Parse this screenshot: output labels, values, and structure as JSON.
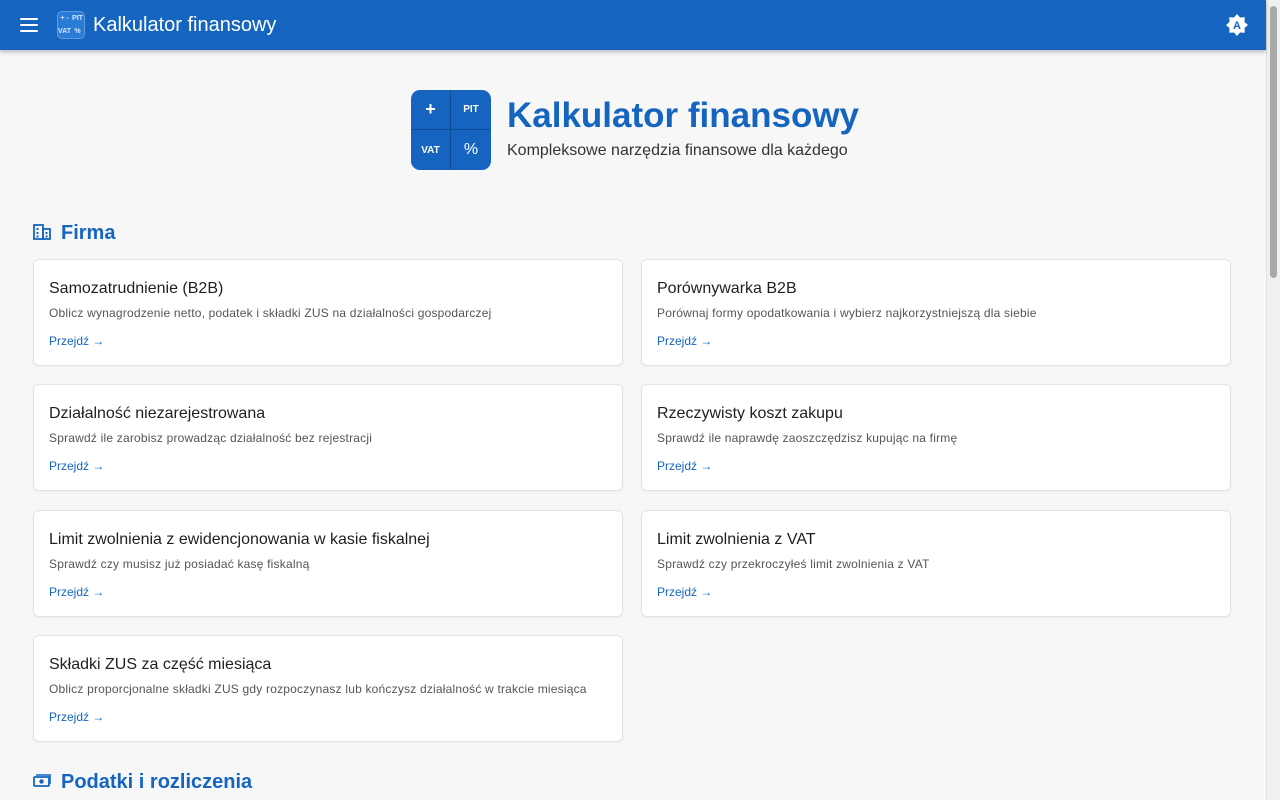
{
  "appbar": {
    "title": "Kalkulator finansowy",
    "logo_cells": [
      "+ -",
      "PIT",
      "VAT",
      "%"
    ],
    "theme_badge": "A"
  },
  "hero": {
    "title": "Kalkulator finansowy",
    "subtitle": "Kompleksowe narzędzia finansowe dla każdego",
    "logo_cells": [
      "+",
      "PIT",
      "VAT",
      "%"
    ]
  },
  "sections": [
    {
      "title": "Firma",
      "icon": "building-icon",
      "cards": [
        {
          "title": "Samozatrudnienie (B2B)",
          "desc": "Oblicz wynagrodzenie netto, podatek i składki ZUS na działalności gospodarczej",
          "link": "Przejdź →"
        },
        {
          "title": "Porównywarka B2B",
          "desc": "Porównaj formy opodatkowania i wybierz najkorzystniejszą dla siebie",
          "link": "Przejdź →"
        },
        {
          "title": "Działalność niezarejestrowana",
          "desc": "Sprawdź ile zarobisz prowadząc działalność bez rejestracji",
          "link": "Przejdź →"
        },
        {
          "title": "Rzeczywisty koszt zakupu",
          "desc": "Sprawdź ile naprawdę zaoszczędzisz kupując na firmę",
          "link": "Przejdź →"
        },
        {
          "title": "Limit zwolnienia z ewidencjonowania w kasie fiskalnej",
          "desc": "Sprawdź czy musisz już posiadać kasę fiskalną",
          "link": "Przejdź →"
        },
        {
          "title": "Limit zwolnienia z VAT",
          "desc": "Sprawdź czy przekroczyłeś limit zwolnienia z VAT",
          "link": "Przejdź →"
        },
        {
          "title": "Składki ZUS za część miesiąca",
          "desc": "Oblicz proporcjonalne składki ZUS gdy rozpoczynasz lub kończysz działalność w trakcie miesiąca",
          "link": "Przejdź →"
        }
      ]
    },
    {
      "title": "Podatki i rozliczenia",
      "icon": "money-icon",
      "cards": []
    }
  ],
  "colors": {
    "primary": "#1565c0",
    "background": "#f7f7f7",
    "card": "#ffffff"
  }
}
